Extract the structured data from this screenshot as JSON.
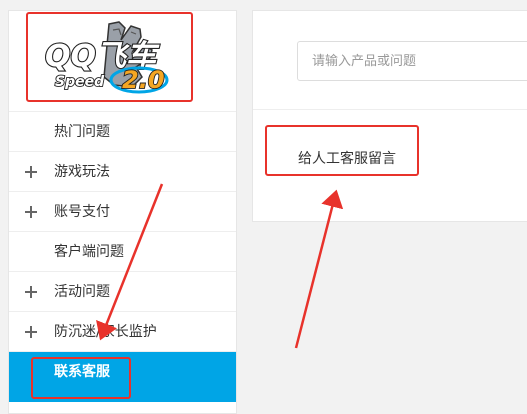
{
  "logo": {
    "text_main": "QQ飞车",
    "text_speed": "Speed",
    "text_version": "2.0"
  },
  "sidebar": {
    "items": [
      {
        "label": "热门问题",
        "expandable": false,
        "active": false
      },
      {
        "label": "游戏玩法",
        "expandable": true,
        "active": false
      },
      {
        "label": "账号支付",
        "expandable": true,
        "active": false
      },
      {
        "label": "客户端问题",
        "expandable": false,
        "active": false
      },
      {
        "label": "活动问题",
        "expandable": true,
        "active": false
      },
      {
        "label": "防沉迷/家长监护",
        "expandable": true,
        "active": false
      },
      {
        "label": "联系客服",
        "expandable": false,
        "active": true
      }
    ]
  },
  "search": {
    "placeholder": "请输入产品或问题",
    "value": ""
  },
  "main": {
    "human_service_label": "给人工客服留言"
  },
  "colors": {
    "accent": "#00a5e6",
    "annotation": "#e8322b",
    "page_bg": "#f2f2f2"
  }
}
